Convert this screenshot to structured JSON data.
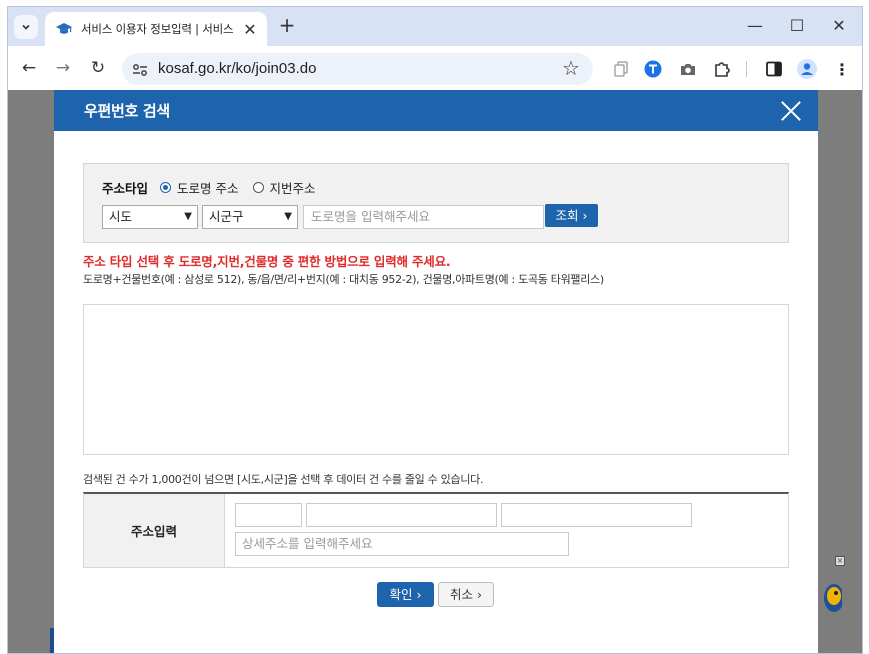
{
  "browser": {
    "tab_title": "서비스 이용자 정보입력 | 서비스 이용",
    "url": "kosaf.go.kr/ko/join03.do",
    "profile_color": "#1a73e8"
  },
  "modal": {
    "title": "우편번호 검색",
    "header_color": "#1e64ad",
    "address_type": {
      "label": "주소타입",
      "options": [
        {
          "label": "도로명 주소",
          "selected": true
        },
        {
          "label": "지번주소",
          "selected": false
        }
      ]
    },
    "sido": {
      "value": "시도"
    },
    "sigungu": {
      "value": "시군구"
    },
    "road_search": {
      "placeholder": "도로명을 입력해주세요"
    },
    "search_button": "조회",
    "warning": "주소 타입 선택 후 도로명,지번,건물명 중 편한 방법으로 입력해 주세요.",
    "hint": "도로명+건물번호(예 : 삼성로 512), 동/읍/면/리+번지(예 : 대치동 952-2), 건물명,아파트명(예 : 도곡동 타워팰리스)",
    "count_note": "검색된 건 수가 1,000건이 넘으면 [시도,시군]을 선택 후 데이터 건 수를 줄일 수 있습니다.",
    "address_input": {
      "label": "주소입력",
      "detail_placeholder": "상세주소를 입력해주세요"
    },
    "confirm_button": "확인",
    "cancel_button": "취소"
  }
}
